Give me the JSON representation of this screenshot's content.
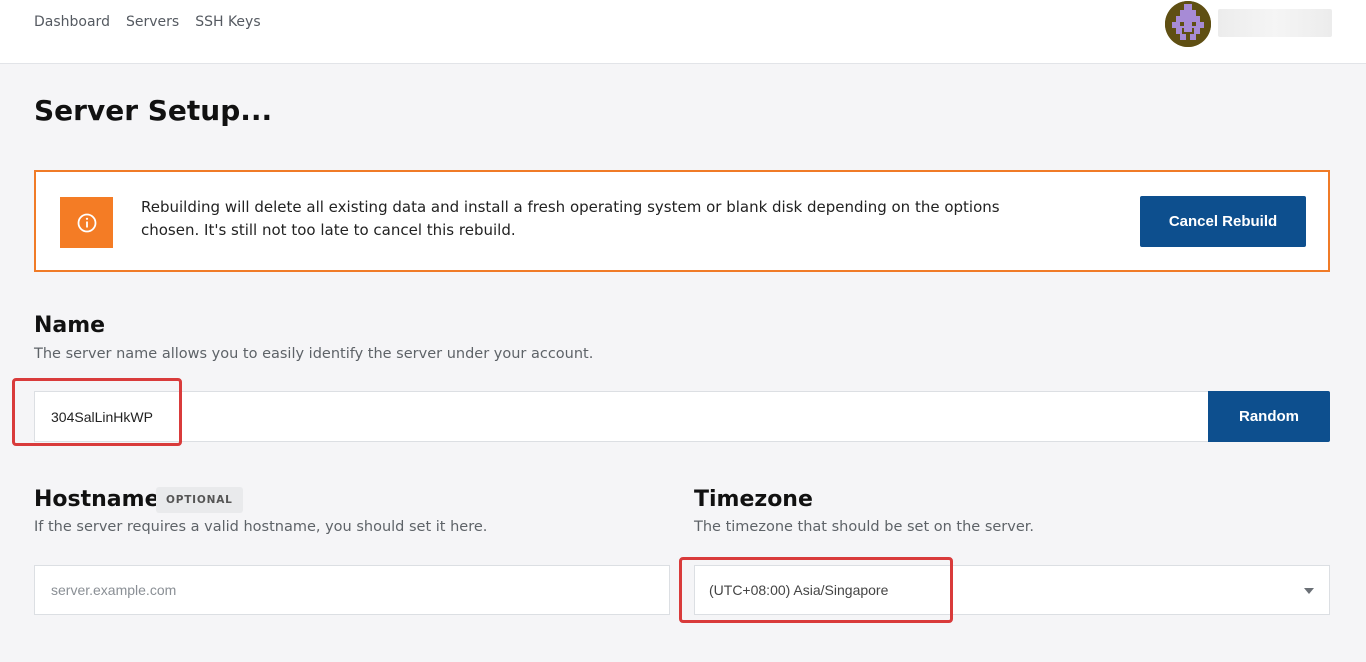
{
  "nav": {
    "items": [
      "Dashboard",
      "Servers",
      "SSH Keys"
    ]
  },
  "user": {
    "avatar_icon": "pixel-invader-avatar",
    "avatar_color": "#5f4f13"
  },
  "page": {
    "title": "Server Setup..."
  },
  "alert": {
    "icon": "info-icon",
    "message": "Rebuilding will delete all existing data and install a fresh operating system or blank disk depending on the options chosen. It's still not too late to cancel this rebuild.",
    "cancel_label": "Cancel Rebuild",
    "border_color": "#f07b27"
  },
  "name_section": {
    "title": "Name",
    "description": "The server name allows you to easily identify the server under your account.",
    "value": "304SalLinHkWP",
    "random_label": "Random"
  },
  "hostname_section": {
    "title": "Hostname",
    "badge": "OPTIONAL",
    "description": "If the server requires a valid hostname, you should set it here.",
    "placeholder": "server.example.com"
  },
  "timezone_section": {
    "title": "Timezone",
    "description": "The timezone that should be set on the server.",
    "selected": "(UTC+08:00) Asia/Singapore"
  },
  "colors": {
    "primary": "#0d4f8e",
    "warning": "#f47c25",
    "highlight": "#d93b3b"
  }
}
